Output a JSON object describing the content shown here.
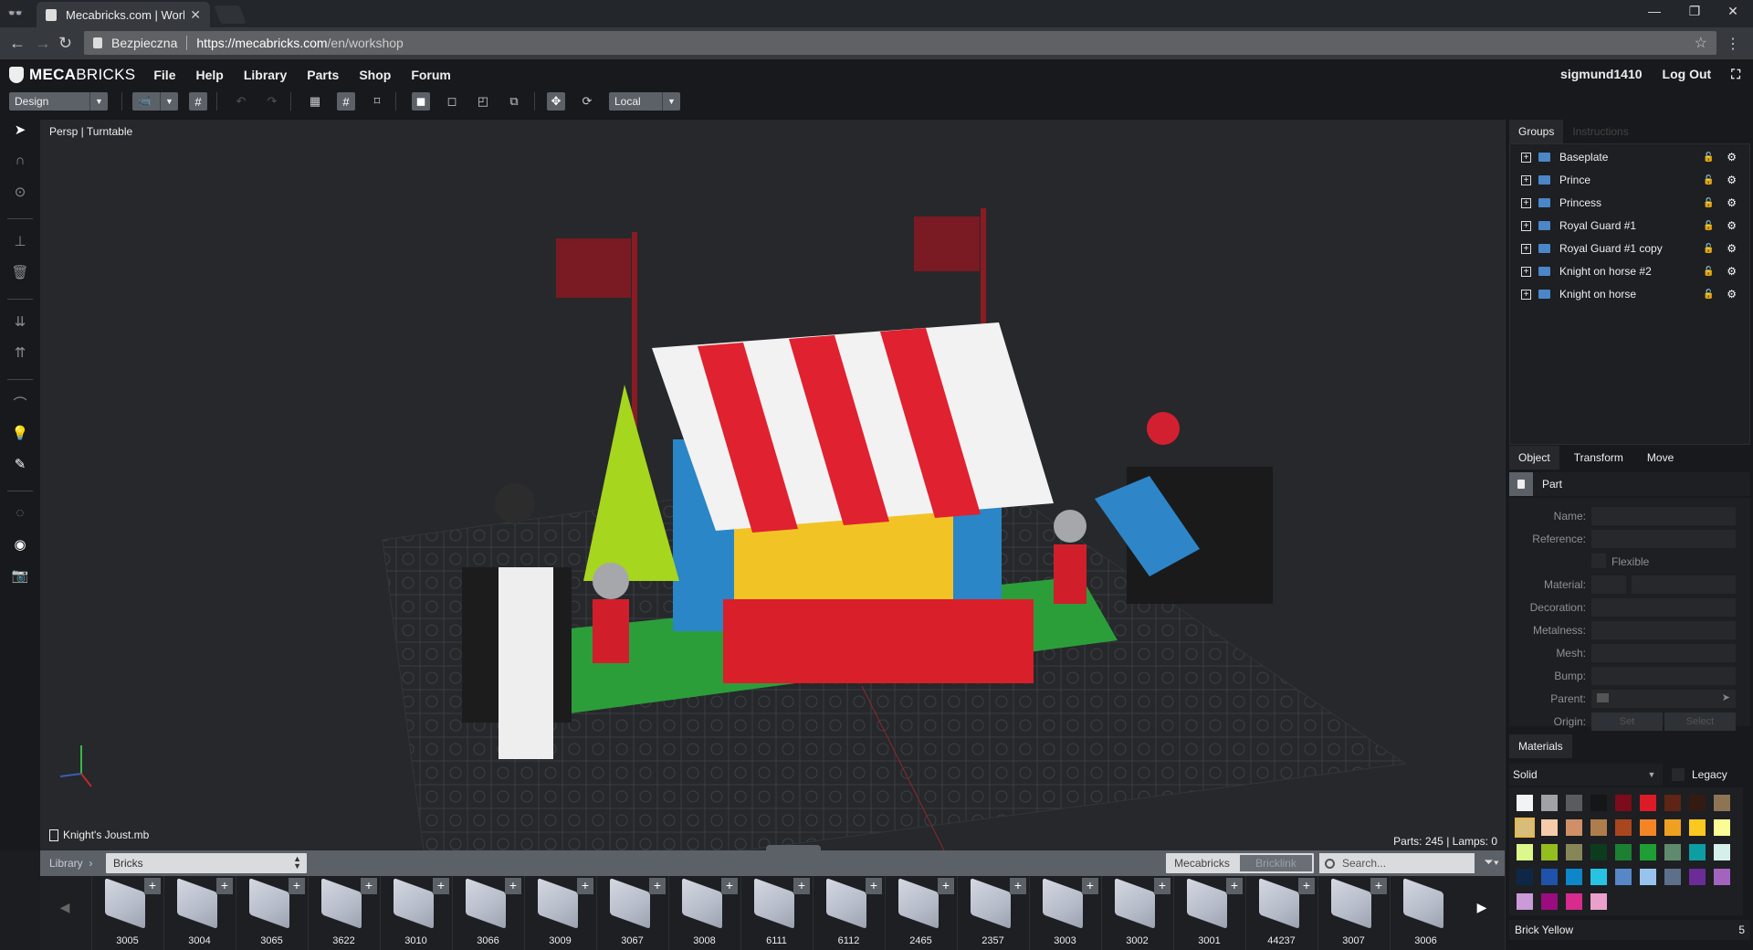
{
  "browser": {
    "tab_title": "Mecabricks.com | Workshop",
    "security_label": "Bezpieczna",
    "url_host": "https://mecabricks.com",
    "url_path": "/en/workshop"
  },
  "app": {
    "brand_bold": "MECA",
    "brand_light": "BRICKS",
    "menu": [
      "File",
      "Help",
      "Library",
      "Parts",
      "Shop",
      "Forum"
    ],
    "username": "sigmund1410",
    "logout": "Log Out"
  },
  "toolbar": {
    "mode": "Design",
    "space": "Local"
  },
  "viewport": {
    "camera_label": "Persp | Turntable",
    "file_name": "Knight's Joust.mb",
    "stats": "Parts: 245 | Lamps: 0"
  },
  "library": {
    "crumb": "Library",
    "category": "Bricks",
    "source_on": "Mecabricks",
    "source_off": "Bricklink",
    "search_placeholder": "Search...",
    "parts": [
      "3005",
      "3004",
      "3065",
      "3622",
      "3010",
      "3066",
      "3009",
      "3067",
      "3008",
      "6111",
      "6112",
      "2465",
      "2357",
      "3003",
      "3002",
      "3001",
      "44237",
      "3007",
      "3006"
    ]
  },
  "groups_panel": {
    "tabs": [
      "Groups",
      "Instructions"
    ],
    "items": [
      "Baseplate",
      "Prince",
      "Princess",
      "Royal Guard #1",
      "Royal Guard #1 copy",
      "Knight on horse #2",
      "Knight on horse"
    ]
  },
  "object_panel": {
    "tabs": [
      "Object",
      "Transform",
      "Move"
    ],
    "type": "Part",
    "fields": [
      "Name:",
      "Reference:",
      "Material:",
      "Decoration:",
      "Metalness:",
      "Mesh:",
      "Bump:",
      "Parent:",
      "Origin:"
    ],
    "flexible_label": "Flexible",
    "origin_set": "Set",
    "origin_select": "Select"
  },
  "materials": {
    "tab": "Materials",
    "type": "Solid",
    "legacy_label": "Legacy",
    "selected_name": "Brick Yellow",
    "selected_count": "5",
    "selected_index": 9,
    "colors": [
      "#f2f3f3",
      "#a0a2a4",
      "#595b5f",
      "#151618",
      "#7c0b1b",
      "#dd1b28",
      "#5e2416",
      "#341b12",
      "#8d7553",
      "#d6bd7a",
      "#f6cba9",
      "#cf8f67",
      "#ad7d4d",
      "#a9461e",
      "#f58427",
      "#f0a021",
      "#fac81e",
      "#fbfc96",
      "#dcf88a",
      "#93be1e",
      "#868659",
      "#0d3b1e",
      "#1b8032",
      "#1e9e34",
      "#5f8a6d",
      "#0d9ea4",
      "#d4f0eb",
      "#0e2746",
      "#1f52ab",
      "#0d87c9",
      "#27c3e3",
      "#5687c8",
      "#98c3ed",
      "#5e6f8b",
      "#6b2c98",
      "#a264bf",
      "#cb9ad9",
      "#9b0c7e",
      "#d72b8e",
      "#eba0cc"
    ]
  }
}
